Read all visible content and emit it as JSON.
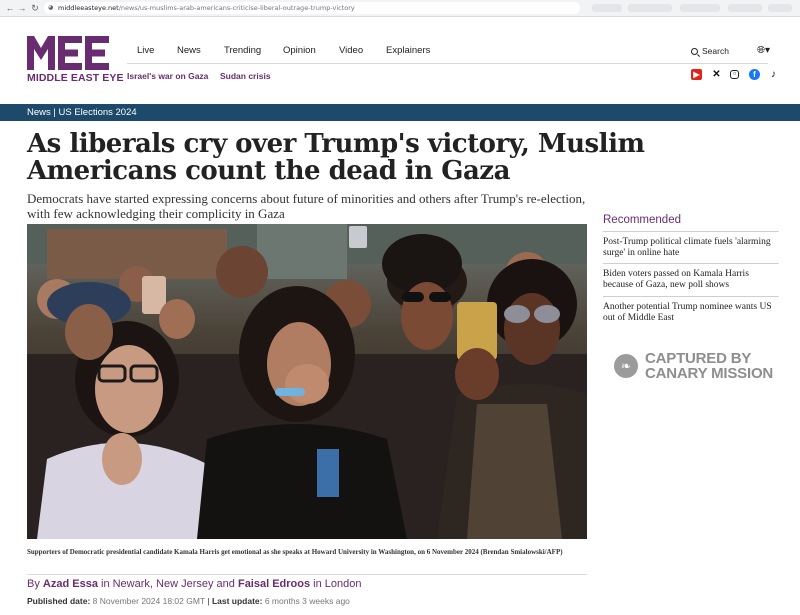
{
  "browser": {
    "url_host": "middleeasteye.net",
    "url_path": "/news/us-muslims-arab-americans-criticise-liberal-outrage-trump-victory"
  },
  "site": {
    "logo_text": "MIDDLE EAST EYE",
    "brand_color": "#6a2c70",
    "nav": [
      "Live",
      "News",
      "Trending",
      "Opinion",
      "Video",
      "Explainers"
    ],
    "subnav": [
      "Israel's war on Gaza",
      "Sudan crisis"
    ],
    "search_label": "Search",
    "socials": [
      "youtube-icon",
      "x-icon",
      "instagram-icon",
      "facebook-icon",
      "tiktok-icon"
    ]
  },
  "breadcrumb": "News | US Elections 2024",
  "article": {
    "headline": "As liberals cry over Trump's victory, Muslim Americans count the dead in Gaza",
    "standfirst": "Democrats have started expressing concerns about future of minorities and others after Trump's re-election, with few acknowledging their complicity in Gaza",
    "caption": "Supporters of Democratic presidential candidate Kamala Harris get emotional as she speaks at Howard University in Washington, on 6 November 2024 (Brendan Smialowski/AFP)",
    "byline": {
      "by": "By",
      "author1": "Azad Essa",
      "in1": "in Newark, New Jersey",
      "and": "and",
      "author2": "Faisal Edroos",
      "in2": "in London"
    },
    "published_label": "Published date:",
    "published_value": "8 November 2024 18:02 GMT",
    "separator": "|",
    "updated_label": "Last update:",
    "updated_value": "6 months 3 weeks ago"
  },
  "recommended": {
    "title": "Recommended",
    "items": [
      "Post-Trump political climate fuels 'alarming surge' in online hate",
      "Biden voters passed on Kamala Harris because of Gaza, new poll shows",
      "Another potential Trump nominee wants US out of Middle East"
    ]
  },
  "canary": {
    "line1": "CAPTURED BY",
    "line2": "CANARY MISSION"
  }
}
